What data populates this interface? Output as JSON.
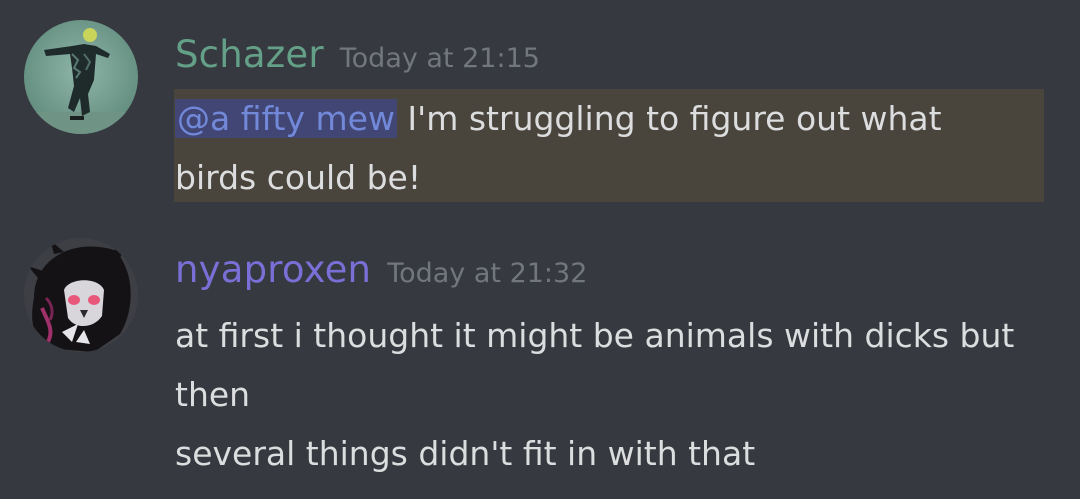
{
  "messages": [
    {
      "author": "Schazer",
      "author_color": "#64a088",
      "timestamp": "Today at 21:15",
      "mention": "@a fifty mew",
      "lines": [
        " I'm struggling to figure out what",
        "birds could be!"
      ],
      "avatar_icon": "avatar-photo-figure"
    },
    {
      "author": "nyaproxen",
      "author_color": "#7a6fd6",
      "timestamp": "Today at 21:32",
      "lines": [
        "at first i thought it might be animals with dicks but",
        "then",
        "several things didn't fit in with that"
      ],
      "avatar_icon": "avatar-dark-creature"
    }
  ],
  "colors": {
    "background": "#36393f",
    "mention_highlight": "#49443c",
    "mention_pill_bg": "#414675",
    "mention_text": "#7289da",
    "message_text": "#dcddde",
    "timestamp": "#72767d"
  }
}
